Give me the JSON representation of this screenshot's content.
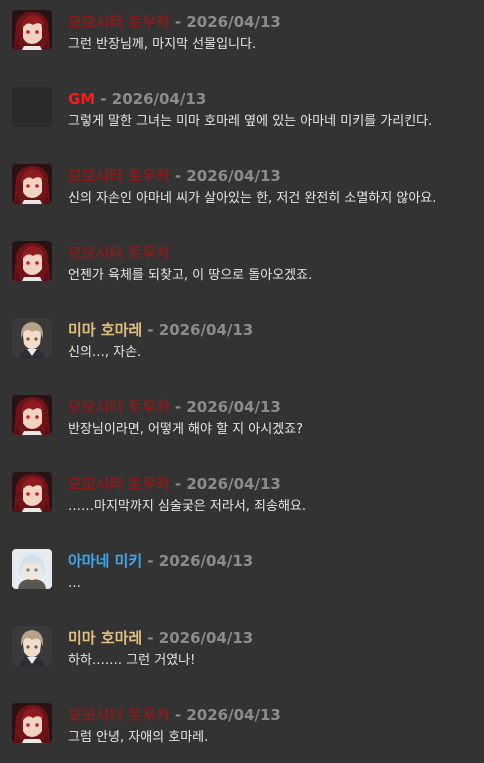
{
  "chat": {
    "separator": "-",
    "messages": [
      {
        "speaker": "모모시타 토우카",
        "speaker_color": "#8b1a1a",
        "avatar": "toka-avatar",
        "date": "2026/04/13",
        "text": "그런 반장님께, 마지막 선물입니다."
      },
      {
        "speaker": "GM",
        "speaker_color": "#ff1a1a",
        "avatar": "gm-avatar",
        "date": "2026/04/13",
        "text": "그렇게 말한 그녀는 미마 호마레 옆에 있는 아마네 미키를 가리킨다."
      },
      {
        "speaker": "모모시타 토우카",
        "speaker_color": "#8b1a1a",
        "avatar": "toka-avatar",
        "date": "2026/04/13",
        "text": "신의 자손인 아마네 씨가 살아있는 한, 저건 완전히 소멸하지 않아요."
      },
      {
        "speaker": "모모시타 토우카",
        "speaker_color": "#8b1a1a",
        "avatar": "toka-avatar",
        "date": "",
        "text": "언젠가 육체를 되찾고, 이 땅으로 돌아오겠죠."
      },
      {
        "speaker": "미마 호마레",
        "speaker_color": "#e0c080",
        "avatar": "homare-avatar",
        "date": "2026/04/13",
        "text": "신의…, 자손."
      },
      {
        "speaker": "모모시타 토우카",
        "speaker_color": "#8b1a1a",
        "avatar": "toka-avatar",
        "date": "2026/04/13",
        "text": "반장님이라면, 어떻게 해야 할 지 아시겠죠?"
      },
      {
        "speaker": "모모시타 토우카",
        "speaker_color": "#8b1a1a",
        "avatar": "toka-avatar",
        "date": "2026/04/13",
        "text": "……마지막까지 심술궂은 저라서, 죄송해요."
      },
      {
        "speaker": "아마네 미키",
        "speaker_color": "#3ba7f0",
        "avatar": "miki-avatar",
        "date": "2026/04/13",
        "text": "…"
      },
      {
        "speaker": "미마 호마레",
        "speaker_color": "#e0c080",
        "avatar": "homare-avatar",
        "date": "2026/04/13",
        "text": "하하……. 그런 거였나!"
      },
      {
        "speaker": "모모시타 토우카",
        "speaker_color": "#8b1a1a",
        "avatar": "toka-avatar",
        "date": "2026/04/13",
        "text": "그럼 안녕, 자애의 호마레."
      }
    ]
  }
}
